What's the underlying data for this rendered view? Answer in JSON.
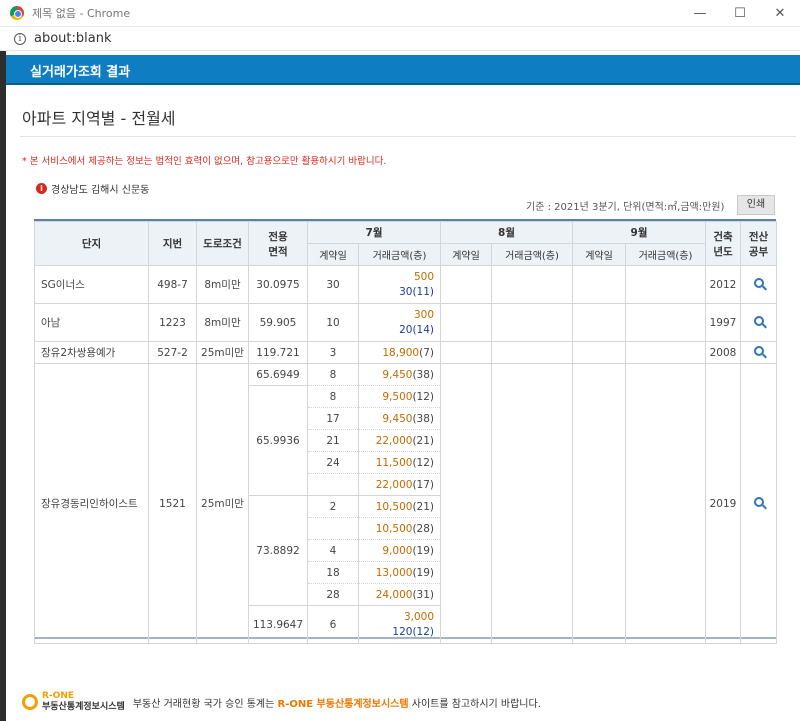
{
  "window": {
    "title": "제목 없음 - Chrome",
    "minimize": "—",
    "maximize": "☐",
    "close": "✕"
  },
  "address": {
    "url": "about:blank"
  },
  "header": {
    "title": "실거래가조회 결과"
  },
  "page": {
    "title": "아파트 지역별 - 전월세",
    "notice": "* 본 서비스에서 제공하는 정보는 법적인 효력이 없으며, 참고용으로만 활용하시기 바랍니다.",
    "region": "경상남도 김해시 신문동",
    "criteria": "기준 : 2021년 3분기, 단위(면적:㎡,금액:만원)",
    "print_label": "인쇄"
  },
  "table": {
    "headers": {
      "complex": "단지",
      "lot": "지번",
      "road": "도로조건",
      "area": "전용\n면적",
      "m7": "7월",
      "m8": "8월",
      "m9": "9월",
      "built": "건축\n년도",
      "ledger": "전산\n공부",
      "contract_day": "계약일",
      "amount": "거래금액(층)"
    },
    "complexes": [
      {
        "name": "SG이너스",
        "lot": "498-7",
        "road": "8m미만",
        "area": "30.0975",
        "day": "30",
        "dep": "500",
        "mon": "30",
        "floor": "(11)",
        "built": "2012"
      },
      {
        "name": "아남",
        "lot": "1223",
        "road": "8m미만",
        "area": "59.905",
        "day": "10",
        "dep": "300",
        "mon": "20",
        "floor": "(14)",
        "built": "1997"
      },
      {
        "name": "장유2차쌍용예가",
        "lot": "527-2",
        "road": "25m미만",
        "area": "119.721",
        "day": "3",
        "dep": "18,900",
        "floor": "(7)",
        "built": "2008"
      }
    ],
    "big": {
      "name": "장유경동리인하이스트",
      "lot": "1521",
      "road": "25m미만",
      "built": "2019",
      "rows": [
        {
          "area": "65.6949",
          "day": "8",
          "amt": "9,450",
          "floor": "(38)"
        },
        {
          "area": "65.9936",
          "day": "8",
          "amt": "9,500",
          "floor": "(12)"
        },
        {
          "day": "17",
          "amt": "9,450",
          "floor": "(38)"
        },
        {
          "day": "21",
          "amt": "22,000",
          "floor": "(21)"
        },
        {
          "day": "24",
          "amt": "11,500",
          "floor": "(12)"
        },
        {
          "day": "",
          "amt": "22,000",
          "floor": "(17)"
        },
        {
          "area": "73.8892",
          "day": "2",
          "amt": "10,500",
          "floor": "(21)"
        },
        {
          "day": "",
          "amt": "10,500",
          "floor": "(28)"
        },
        {
          "day": "4",
          "amt": "9,000",
          "floor": "(19)"
        },
        {
          "day": "18",
          "amt": "13,000",
          "floor": "(19)"
        },
        {
          "day": "28",
          "amt": "24,000",
          "floor": "(31)"
        },
        {
          "area": "113.9647",
          "day": "6",
          "dep": "3,000",
          "mon": "120",
          "floor": "(12)"
        }
      ]
    }
  },
  "footer": {
    "logo_top": "R-ONE",
    "logo_bottom": "부동산통계정보시스템",
    "text1": "부동산 거래현황 국가 승인 통계는",
    "highlight": "R-ONE 부동산통계정보시스템",
    "text2": "사이트를 참고하시기 바랍니다."
  },
  "colors": {
    "header_bg": "#0e7dc2",
    "deposit": "#c46a00",
    "monthly": "#1a3fa0",
    "notice": "#d9281e"
  }
}
